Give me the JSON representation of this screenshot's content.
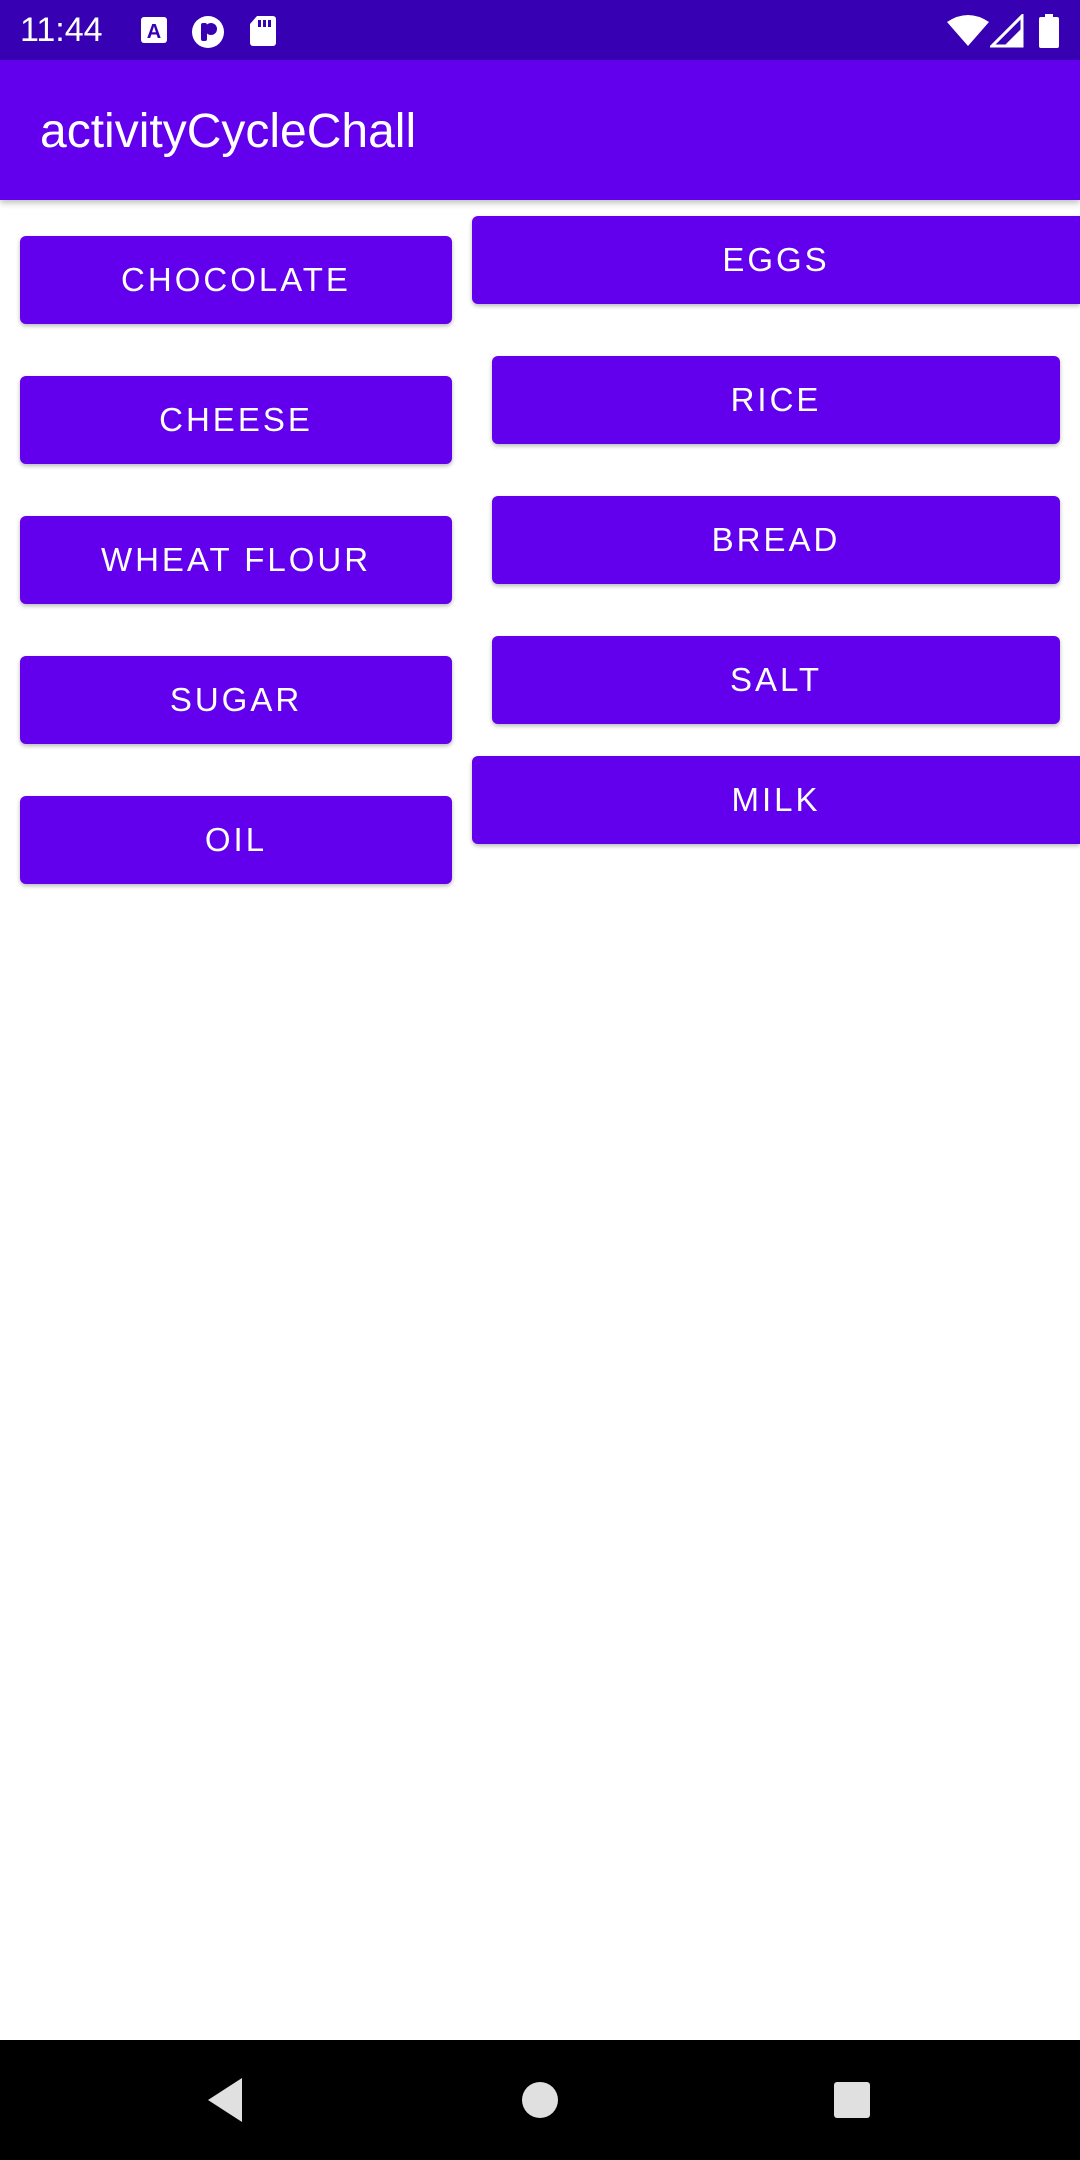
{
  "status_bar": {
    "time": "11:44",
    "icons": [
      "accessibility-a-icon",
      "podcast-p-icon",
      "sd-card-icon",
      "wifi-icon",
      "signal-icon",
      "battery-icon"
    ]
  },
  "app_bar": {
    "title": "activityCycleChall"
  },
  "left_buttons": [
    {
      "label": "CHOCOLATE"
    },
    {
      "label": "CHEESE"
    },
    {
      "label": "WHEAT FLOUR"
    },
    {
      "label": "SUGAR"
    },
    {
      "label": "OIL"
    }
  ],
  "right_buttons": [
    {
      "label": "EGGS"
    },
    {
      "label": "RICE"
    },
    {
      "label": "BREAD"
    },
    {
      "label": "SALT"
    },
    {
      "label": "MILK"
    }
  ],
  "nav_bar": {
    "icons": [
      "back-icon",
      "home-icon",
      "recents-icon"
    ]
  },
  "colors": {
    "primary": "#6200ee",
    "primary_dark": "#3700b3",
    "on_primary": "#ffffff",
    "nav_bar": "#000000"
  }
}
